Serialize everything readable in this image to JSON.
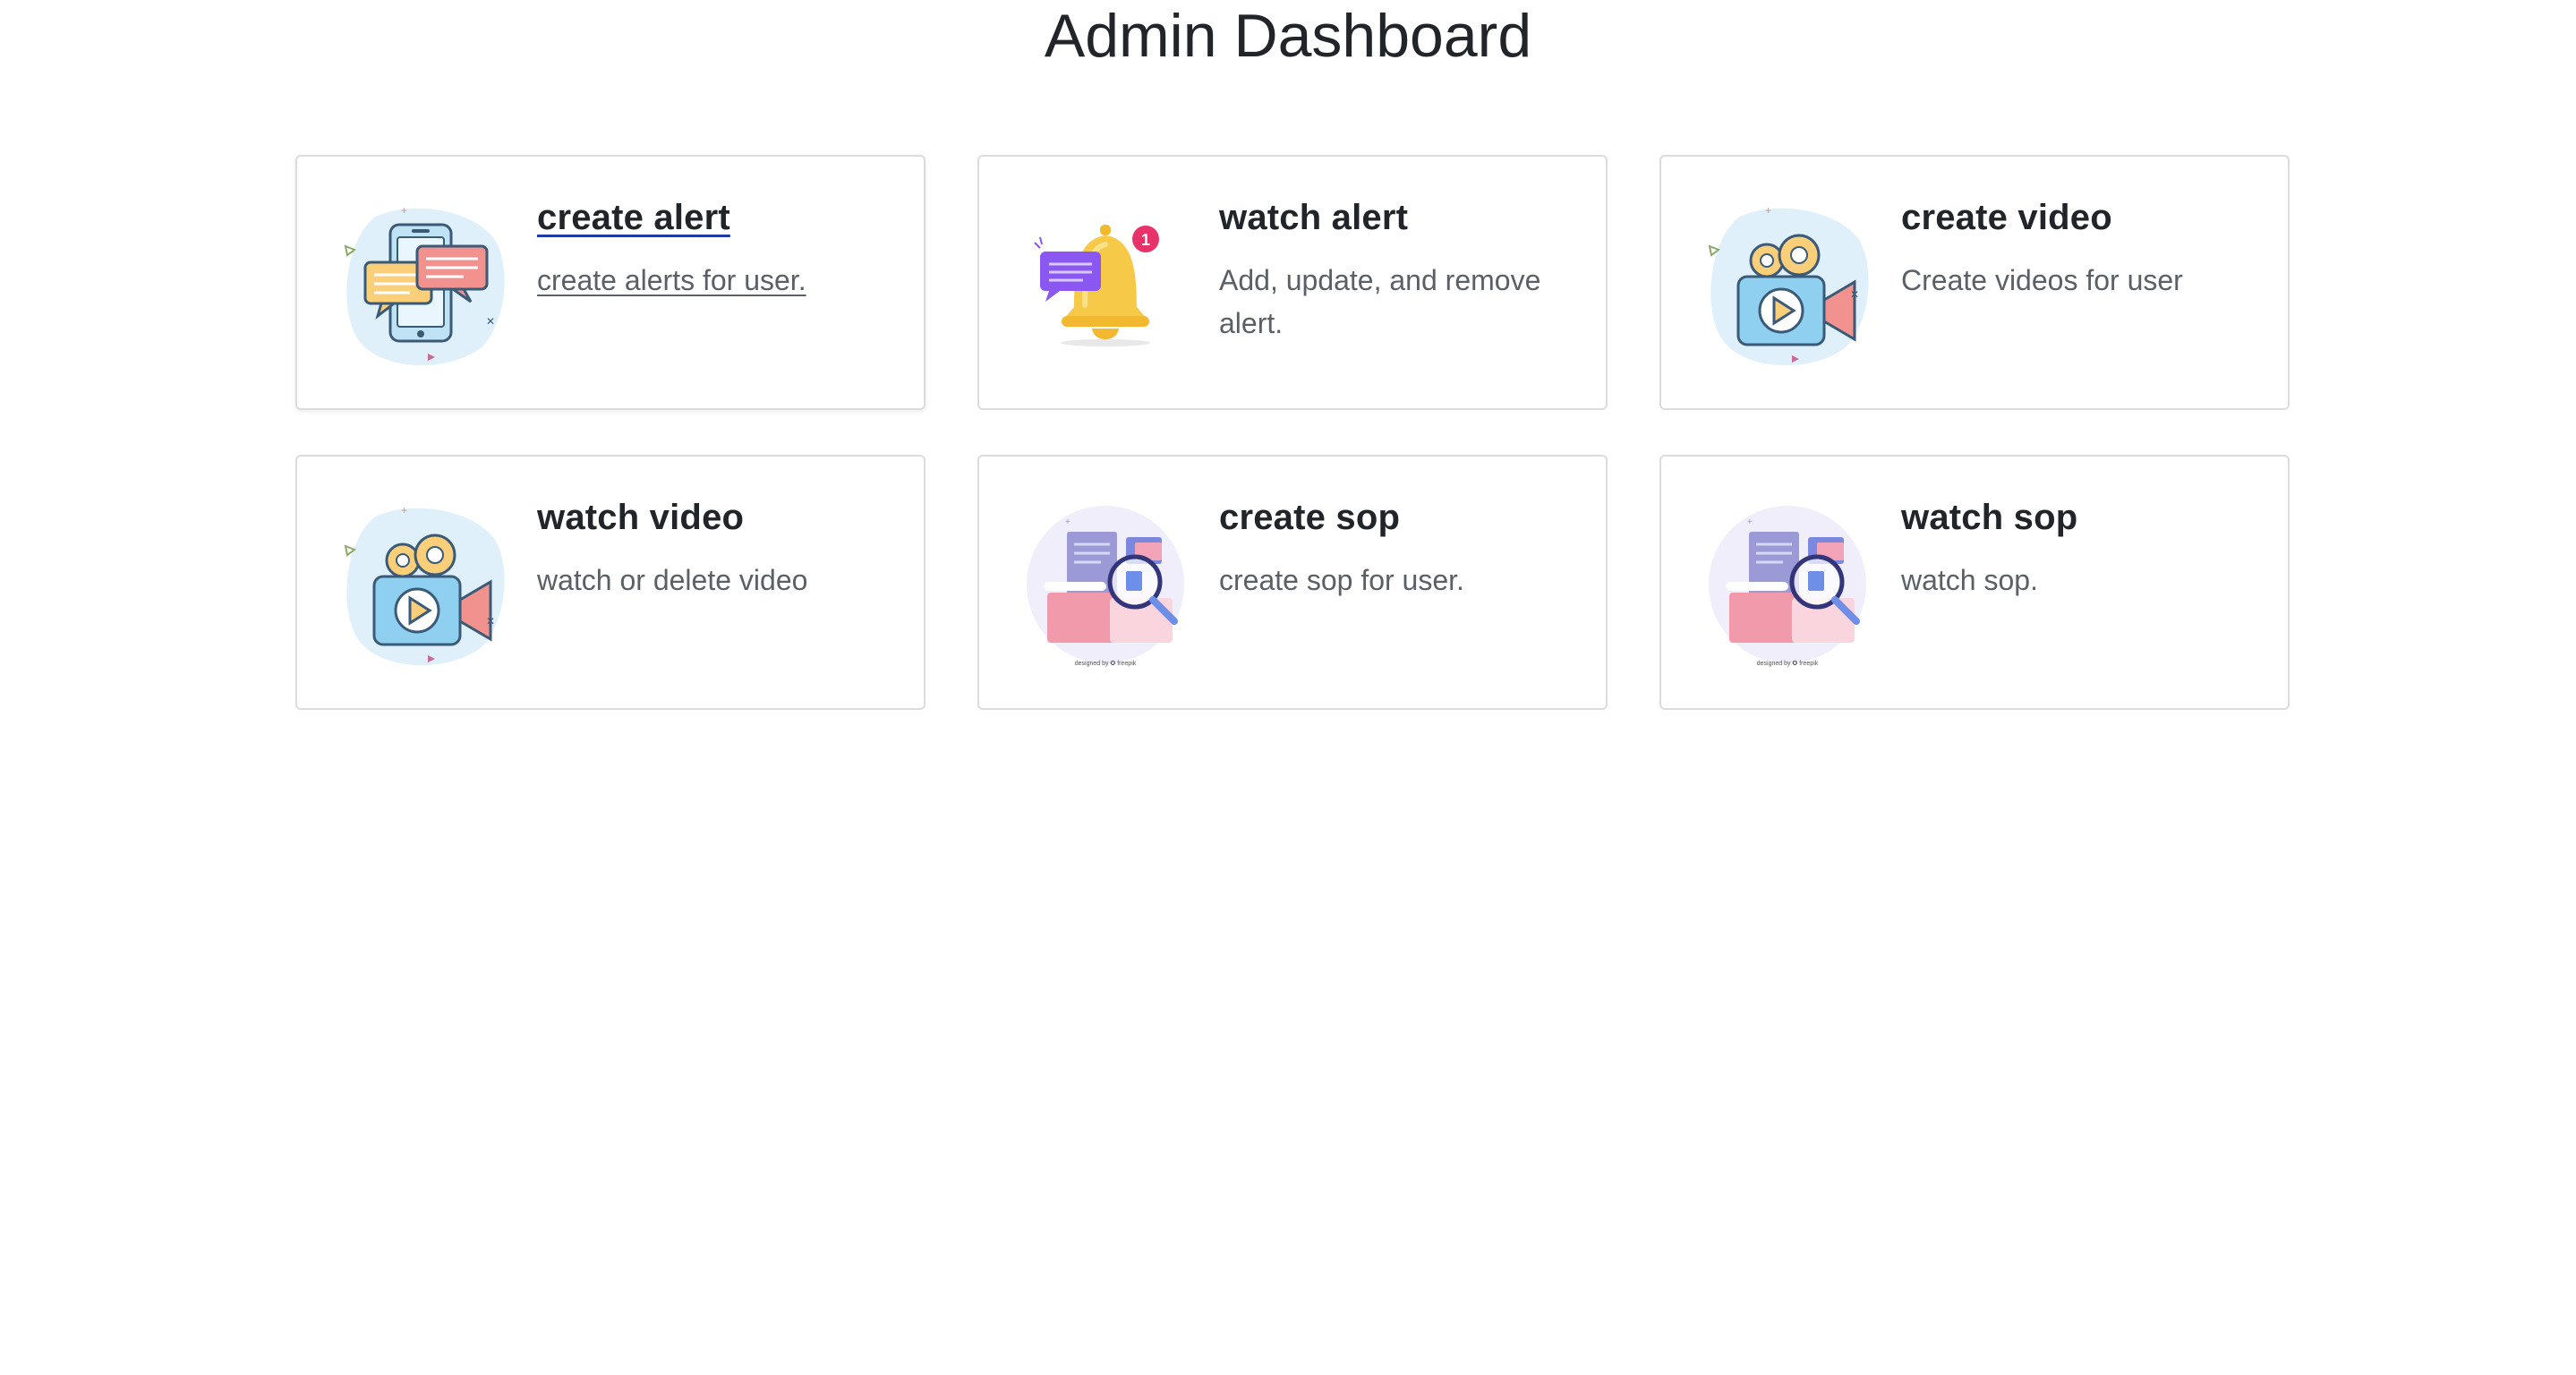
{
  "page": {
    "title": "Admin Dashboard"
  },
  "cards": [
    {
      "title": "create alert",
      "description": "create alerts for user.",
      "icon": "chat-phone-icon",
      "hovered": true
    },
    {
      "title": "watch alert",
      "description": "Add, update, and remove alert.",
      "icon": "bell-notification-icon",
      "hovered": false
    },
    {
      "title": "create video",
      "description": "Create videos for user",
      "icon": "video-camera-icon",
      "hovered": false
    },
    {
      "title": "watch video",
      "description": "watch or delete video",
      "icon": "video-camera-icon",
      "hovered": false
    },
    {
      "title": "create sop",
      "description": "create sop for user.",
      "icon": "document-search-icon",
      "hovered": false
    },
    {
      "title": "watch sop",
      "description": "watch sop.",
      "icon": "document-search-icon",
      "hovered": false
    }
  ],
  "colors": {
    "badge": "#e8326a",
    "bell": "#f7c948",
    "chat_purple": "#8a57f0",
    "blob": "#dff0fb",
    "hover_underline": "#1f3aa6"
  }
}
